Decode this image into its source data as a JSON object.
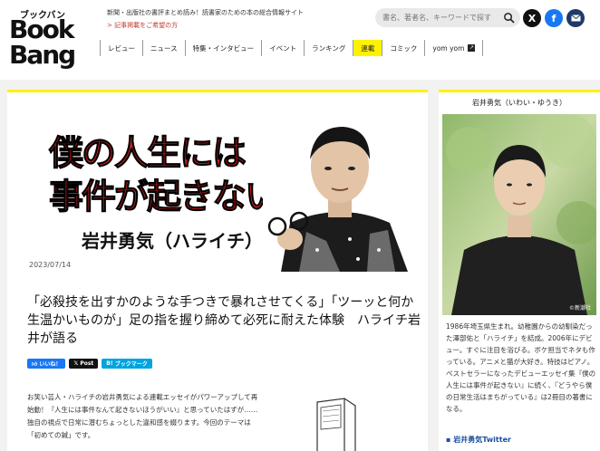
{
  "site": {
    "logo_kana": "ブックバン",
    "logo_word1": "Book",
    "logo_word2": "Bang",
    "tagline": "新聞・出版社の書評まとめ読み！読書家のための本の総合情報サイト",
    "sublink": "> 記事掲載をご希望の方"
  },
  "search": {
    "placeholder": "書名、著者名、キーワードで探す",
    "icon": "search-icon"
  },
  "social": {
    "x_label": "X",
    "facebook_label": "f",
    "mail_icon": "mail-icon",
    "x_color": "#111111",
    "facebook_color": "#1877f2",
    "mail_color": "#1f3a68"
  },
  "nav": {
    "items": [
      "レビュー",
      "ニュース",
      "特集・インタビュー",
      "イベント",
      "ランキング",
      "連載",
      "コミック",
      "yom yom"
    ],
    "active_color": "#fff200"
  },
  "hero": {
    "title_line1": "僕の人生には",
    "title_line2": "事件が起きない",
    "author": "岩井勇気（ハライチ）"
  },
  "article": {
    "date": "2023/07/14",
    "headline": "「必殺技を出すかのような手つきで暴れさせてくる」「ツーッと何か生温かいものが」足の指を握り締めて必死に耐えた体験　ハライチ岩井が語る",
    "share": {
      "like": "いいね！",
      "post": "Post",
      "bookmark": "ブックマーク",
      "like_color": "#1877f2",
      "post_color": "#111111",
      "bookmark_color": "#00a4de"
    },
    "body": "お笑い芸人・ハライチの岩井勇気による連載エッセイがパワーアップして再始動！『人生には事件なんて起きないほうがいい』と思っていたはずが……独自の視点で日常に潜むちょっとした違和感を綴ります。今回のテーマは「初めての鍼」です。"
  },
  "sidebar": {
    "title": "岩井勇気（いわい・ゆうき）",
    "photo_credit": "©新潮社",
    "bio": "1986年埼玉県生まれ。幼稚園からの幼馴染だった澤部佑と「ハライチ」を結成。2006年にデビュー。すぐに注目を浴びる。ボケ担当でネタも作っている。アニメと猫が大好き。特技はピアノ。ベストセラーになったデビューエッセイ集『僕の人生には事件が起きない』に続く、『どうやら僕の日常生活はまちがっている』は2冊目の著書になる。",
    "twitter_link": "岩井勇気Twitter"
  }
}
